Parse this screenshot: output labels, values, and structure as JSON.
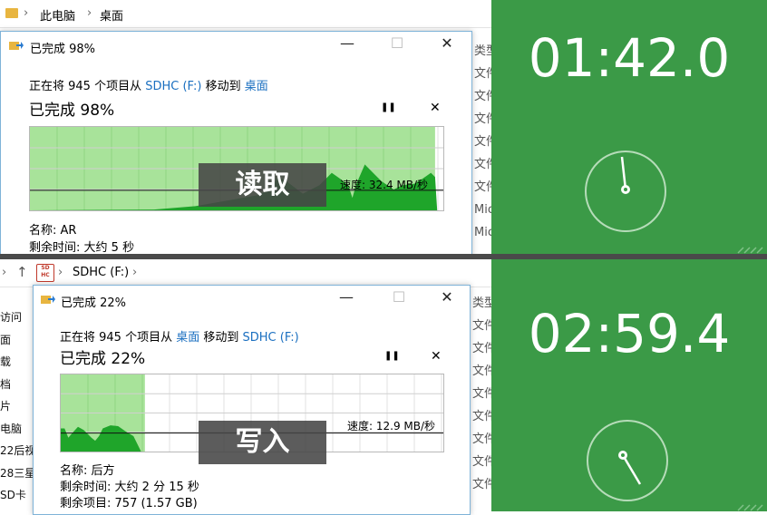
{
  "top": {
    "breadcrumb": [
      "此电脑",
      "桌面"
    ],
    "right_column": [
      "类型",
      "文件",
      "文件",
      "文件",
      "文件",
      "文件",
      "文件",
      "Mic",
      "Mic"
    ],
    "dialog": {
      "title": "已完成 98%",
      "line_prefix": "正在将 945 个项目从 ",
      "source": "SDHC (F:)",
      "line_mid": " 移动到 ",
      "dest": "桌面",
      "big_status": "已完成 98%",
      "pause": "❚❚",
      "cancel": "✕",
      "speed": "速度: 32.4 MB/秒",
      "name_label": "名称:",
      "name_value": "AR",
      "remaining_label": "剩余时间:",
      "remaining_value": "大约 5 秒",
      "progress_percent": 98
    },
    "overlay_label": "读取",
    "timer": "01:42.0"
  },
  "bottom": {
    "breadcrumb": [
      "SDHC (F:)"
    ],
    "drive_icon_text": "SD HC",
    "left_column": [
      "访问",
      "面",
      "载",
      "档",
      "片",
      "电脑",
      "22后视",
      "28三星",
      "SD卡"
    ],
    "right_column": [
      "类型",
      "文件",
      "文件",
      "文件",
      "文件",
      "文件",
      "文件",
      "文件",
      "文件"
    ],
    "dialog": {
      "title": "已完成 22%",
      "line_prefix": "正在将 945 个项目从 ",
      "source": "桌面",
      "line_mid": " 移动到 ",
      "dest": "SDHC (F:)",
      "big_status": "已完成 22%",
      "pause": "❚❚",
      "cancel": "✕",
      "speed": "速度: 12.9 MB/秒",
      "name_label": "名称:",
      "name_value": "后方",
      "remaining_label": "剩余时间:",
      "remaining_value": "大约 2 分 15 秒",
      "items_label": "剩余项目:",
      "items_value": "757 (1.57 GB)",
      "progress_percent": 22
    },
    "overlay_label": "写入",
    "timer": "02:59.4"
  },
  "colors": {
    "timer_green": "#3b9a47",
    "chart_fill_light": "#a8e39a",
    "chart_fill_dark": "#1fa52a",
    "link_blue": "#1a6fc0"
  }
}
